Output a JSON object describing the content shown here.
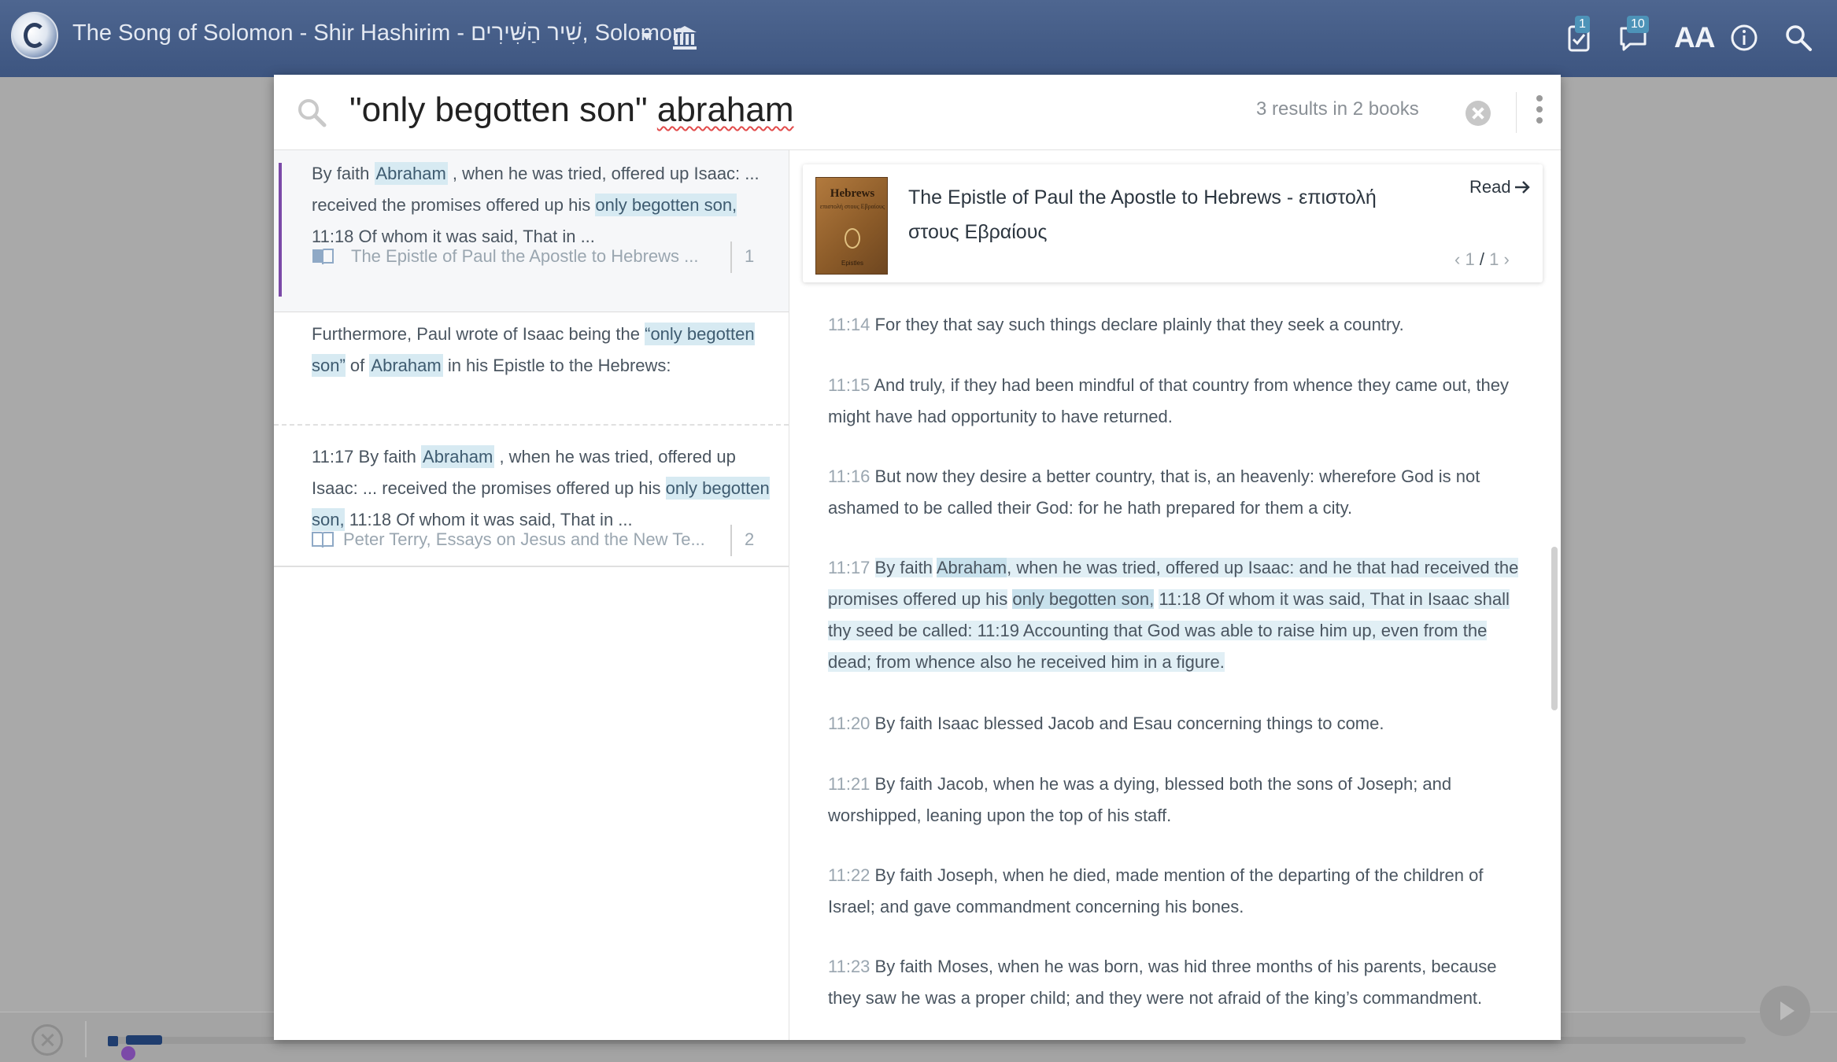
{
  "topbar": {
    "title": "The Song of Solomon - Shir Hashirim - שִׁיר הַשִּׁירִים, Solomon",
    "notes_badge": "1",
    "comments_badge": "10",
    "font_size_label": "AA"
  },
  "search": {
    "query_phrase": "\"only begotten son\"",
    "query_word": "abraham",
    "result_count": "3 results in 2 books"
  },
  "results": [
    {
      "snippet": {
        "p1": "By faith",
        "hl1": "Abraham",
        "p2": ", when he was tried, offered up Isaac: ... received the promises offered up his",
        "hl2": "only begotten son,",
        "p3": "11:18 Of whom it was said, That in ..."
      },
      "source": "The Epistle of Paul the Apostle to Hebrews ...",
      "count": "1"
    },
    {
      "intro": {
        "p1": "Furthermore, Paul wrote of Isaac being the",
        "hl1": "“only begotten son”",
        "p2": "of",
        "hl2": "Abraham",
        "p3": "in his Epistle to the Hebrews:"
      },
      "snippet": {
        "p1": "11:17 By faith",
        "hl1": "Abraham",
        "p2": ", when he was tried, offered up Isaac: ... received the promises offered up his",
        "hl2": "only begotten son,",
        "p3": "11:18 Of whom it was said, That in ..."
      },
      "source": "Peter Terry,  Essays on Jesus and the New Te...",
      "count": "2"
    }
  ],
  "reader": {
    "book_title": "The Epistle of Paul the Apostle to Hebrews - επιστολή στους Εβραίους",
    "read_label": "Read",
    "pager_current": "1",
    "pager_total": "1",
    "cover": {
      "title": "Hebrews",
      "subtitle": "επιστολή στους Εβραίους",
      "footer": "Epistles"
    },
    "verses": [
      {
        "num": "11:14",
        "text": "For they that say such things declare plainly that they seek a country."
      },
      {
        "num": "11:15",
        "text": "And truly, if they had been mindful of that country from whence they came out, they might have had opportunity to have returned."
      },
      {
        "num": "11:16",
        "text": "But now they desire a better country, that is, an heavenly: wherefore God is not ashamed to be called their God: for he hath prepared for them a city."
      },
      {
        "num": "11:17",
        "p1": "By faith",
        "hl1": "Abraham",
        "p2": ", when he was tried, offered up Isaac: and he that had received the promises offered up his",
        "hl2": "only begotten son,",
        "p3": "11:18 Of whom it was said, That in Isaac shall thy seed be called: 11:19 Accounting that God was able to raise him up, even from the dead; from whence also he received him in a figure."
      },
      {
        "num": "11:20",
        "text": "By faith Isaac blessed Jacob and Esau concerning things to come."
      },
      {
        "num": "11:21",
        "text": "By faith Jacob, when he was a dying, blessed both the sons of Joseph; and worshipped, leaning upon the top of his staff."
      },
      {
        "num": "11:22",
        "text": "By faith Joseph, when he died, made mention of the departing of the children of Israel; and gave commandment concerning his bones."
      },
      {
        "num": "11:23",
        "text": "By faith Moses, when he was born, was hid three months of his parents, because they saw he was a proper child; and they were not afraid of the king’s commandment."
      }
    ]
  },
  "playback": {
    "progress": 0.03
  },
  "colors": {
    "topbar": "#4e6690",
    "accent": "#7b4aa8",
    "highlight": "#d7eaf2"
  },
  "icons": [
    "logo-icon",
    "library-icon",
    "notes-icon",
    "comments-icon",
    "info-icon",
    "search-icon",
    "clear-icon",
    "more-icon",
    "book-icon",
    "arrow-right-icon",
    "chevron-left-icon",
    "chevron-right-icon",
    "close-icon",
    "play-icon"
  ]
}
